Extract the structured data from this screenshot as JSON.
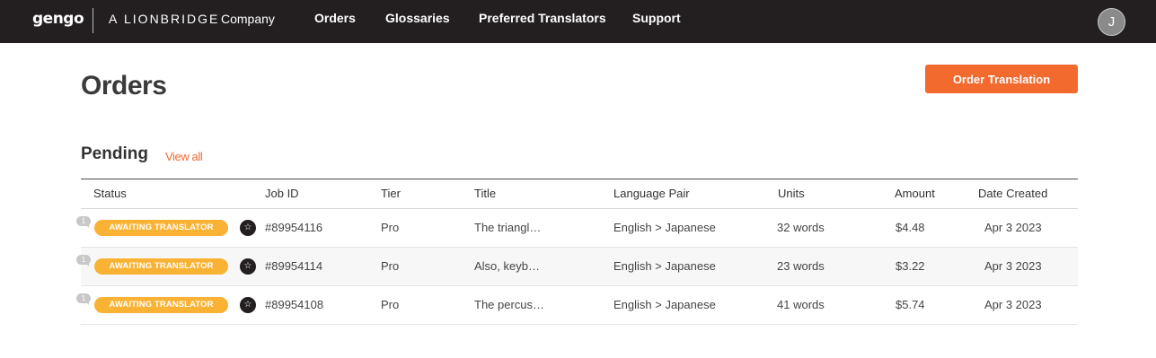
{
  "header": {
    "logo": "gengo",
    "lionbridge_prefix": "A",
    "lionbridge_brand": "LIONBRIDGE",
    "lionbridge_company": "Company",
    "nav": [
      "Orders",
      "Glossaries",
      "Preferred Translators",
      "Support"
    ],
    "avatar_initial": "J"
  },
  "page": {
    "title": "Orders",
    "order_button_label": "Order Translation"
  },
  "section": {
    "title": "Pending",
    "view_all_label": "View all"
  },
  "table": {
    "columns": [
      "Status",
      "Job ID",
      "Tier",
      "Title",
      "Language Pair",
      "Units",
      "Amount",
      "Date Created"
    ],
    "rows": [
      {
        "comment_count": "1",
        "status": "AWAITING TRANSLATOR",
        "job_id": "#89954116",
        "tier": "Pro",
        "title": "The triangl…",
        "language_pair": "English > Japanese",
        "units": "32 words",
        "amount": "$4.48",
        "date_created": "Apr 3 2023"
      },
      {
        "comment_count": "1",
        "status": "AWAITING TRANSLATOR",
        "job_id": "#89954114",
        "tier": "Pro",
        "title": "Also, keyb…",
        "language_pair": "English > Japanese",
        "units": "23 words",
        "amount": "$3.22",
        "date_created": "Apr 3 2023"
      },
      {
        "comment_count": "1",
        "status": "AWAITING TRANSLATOR",
        "job_id": "#89954108",
        "tier": "Pro",
        "title": "The percus…",
        "language_pair": "English > Japanese",
        "units": "41 words",
        "amount": "$5.74",
        "date_created": "Apr 3 2023"
      }
    ]
  },
  "icons": {
    "favorite": "star-icon",
    "comment": "comment-icon",
    "avatar": "user-avatar"
  },
  "colors": {
    "topbar": "#231f20",
    "accent": "#f26a2e",
    "status_awaiting": "#f9b233"
  }
}
